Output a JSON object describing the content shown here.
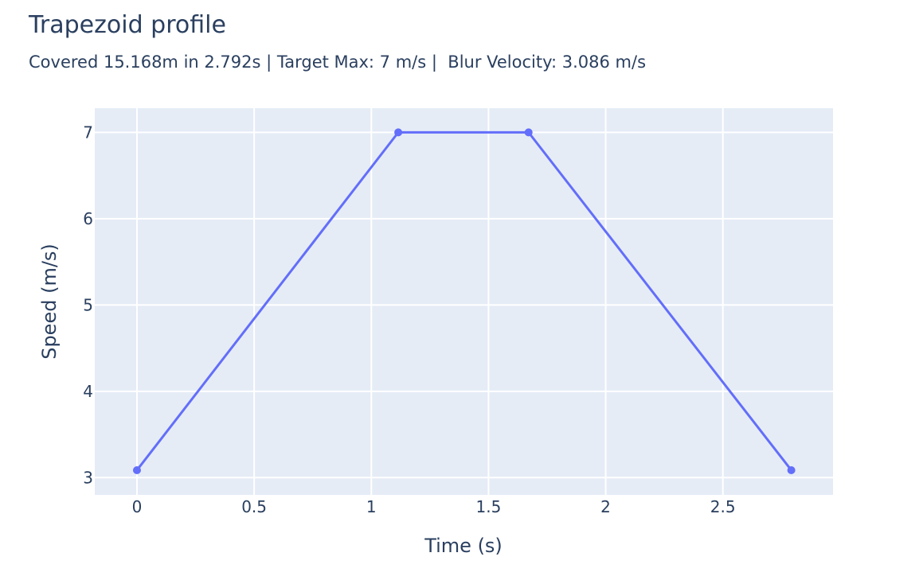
{
  "chart_data": {
    "type": "line",
    "title": "Trapezoid profile",
    "subtitle": "Covered 15.168m in 2.792s | Target Max: 7 m/s |  Blur Velocity: 3.086 m/s",
    "xlabel": "Time (s)",
    "ylabel": "Speed (m/s)",
    "xlim": [
      -0.18,
      2.97
    ],
    "ylim": [
      2.8,
      7.28
    ],
    "x_ticks": [
      0,
      0.5,
      1,
      1.5,
      2,
      2.5
    ],
    "x_tick_labels": [
      "0",
      "0.5",
      "1",
      "1.5",
      "2",
      "2.5"
    ],
    "y_ticks": [
      3,
      4,
      5,
      6,
      7
    ],
    "y_tick_labels": [
      "3",
      "4",
      "5",
      "6",
      "7"
    ],
    "grid": true,
    "colors": {
      "plot_bg": "#e5ecf6",
      "grid": "#ffffff",
      "line": "#636efa",
      "text": "#2a3f5f"
    },
    "series": [
      {
        "x": [
          0,
          1.115,
          1.671,
          2.792
        ],
        "y": [
          3.086,
          7,
          7,
          3.086
        ],
        "mode": "lines+markers"
      }
    ]
  }
}
